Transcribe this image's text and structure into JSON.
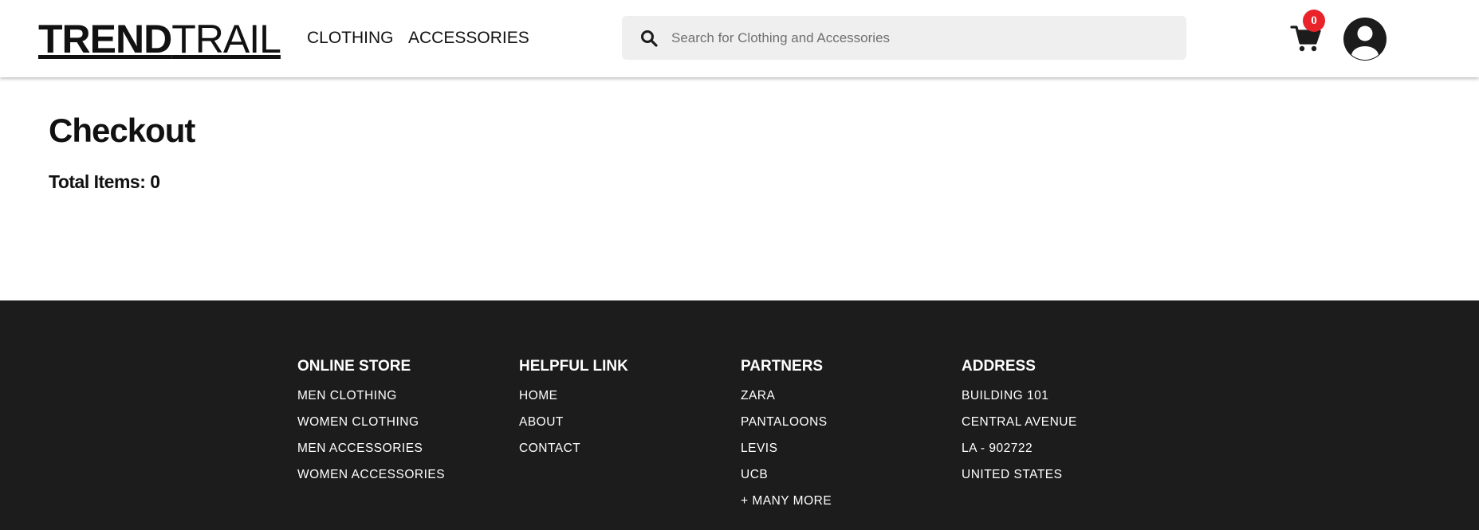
{
  "header": {
    "logo_bold": "TREND",
    "logo_light": "TRAIL",
    "nav": [
      {
        "label": "CLOTHING"
      },
      {
        "label": "ACCESSORIES"
      }
    ],
    "search": {
      "placeholder": "Search for Clothing and Accessories",
      "value": "",
      "icon": "search-icon"
    },
    "cart": {
      "icon": "cart-icon",
      "count": "0",
      "badge_color": "#e8232a"
    },
    "avatar": {
      "icon": "user-circle-icon"
    }
  },
  "main": {
    "title": "Checkout",
    "total_items_label": "Total Items: 0"
  },
  "footer": {
    "background": "#1c1c1d",
    "columns": [
      {
        "heading": "ONLINE STORE",
        "items": [
          "MEN CLOTHING",
          "WOMEN CLOTHING",
          "MEN ACCESSORIES",
          "WOMEN ACCESSORIES"
        ]
      },
      {
        "heading": "HELPFUL LINK",
        "items": [
          "HOME",
          "ABOUT",
          "CONTACT"
        ]
      },
      {
        "heading": "PARTNERS",
        "items": [
          "ZARA",
          "PANTALOONS",
          "LEVIS",
          "UCB",
          "+ MANY MORE"
        ]
      },
      {
        "heading": "ADDRESS",
        "items": [
          "BUILDING 101",
          "CENTRAL AVENUE",
          "LA - 902722",
          "UNITED STATES"
        ]
      }
    ]
  }
}
